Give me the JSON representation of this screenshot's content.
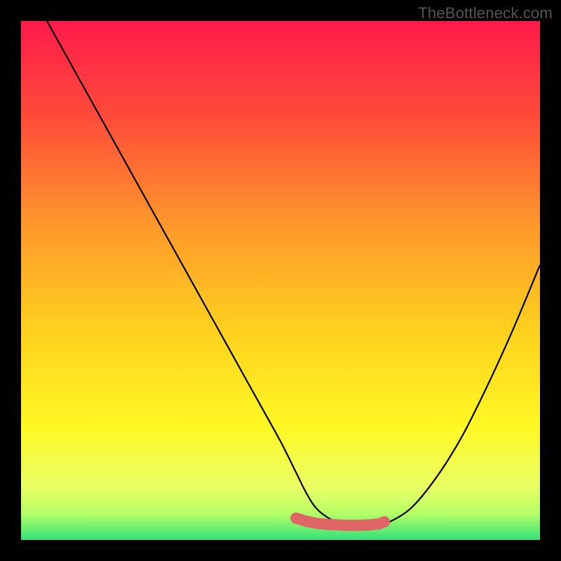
{
  "watermark": {
    "text": "TheBottleneck.com"
  },
  "colors": {
    "frame": "#000000",
    "curve": "#000000",
    "marker_fill": "#e06666",
    "marker_stroke": "#c94d4d",
    "gradient_stops": [
      {
        "offset": 0.0,
        "color": "#ff1a4b"
      },
      {
        "offset": 0.18,
        "color": "#ff4a3a"
      },
      {
        "offset": 0.4,
        "color": "#ff9a2a"
      },
      {
        "offset": 0.6,
        "color": "#ffd21f"
      },
      {
        "offset": 0.78,
        "color": "#fff823"
      },
      {
        "offset": 0.9,
        "color": "#eaff66"
      },
      {
        "offset": 0.95,
        "color": "#b3ff66"
      },
      {
        "offset": 1.0,
        "color": "#33e07a"
      }
    ]
  },
  "chart_data": {
    "type": "line",
    "title": "",
    "xlabel": "",
    "ylabel": "",
    "xlim": [
      0,
      100
    ],
    "ylim": [
      0,
      100
    ],
    "series": [
      {
        "name": "bottleneck-curve",
        "x": [
          5,
          10,
          15,
          20,
          25,
          30,
          35,
          40,
          45,
          50,
          53,
          55,
          57,
          60,
          63,
          65,
          68,
          70,
          75,
          80,
          85,
          90,
          95,
          100
        ],
        "y": [
          100,
          91,
          82,
          73,
          64,
          55,
          46,
          37,
          28,
          19,
          13,
          9,
          6,
          3.8,
          2.8,
          2.5,
          2.5,
          3,
          6,
          12,
          20,
          30,
          41,
          53
        ]
      }
    ],
    "markers": {
      "name": "optimal-range-band",
      "x": [
        53,
        55,
        57,
        59,
        61,
        63,
        65,
        67,
        69,
        70
      ],
      "y": [
        4.2,
        3.6,
        3.2,
        3.0,
        2.9,
        2.8,
        2.8,
        2.9,
        3.1,
        3.5
      ]
    },
    "end_dot": {
      "x": 70,
      "y": 3.5
    }
  }
}
